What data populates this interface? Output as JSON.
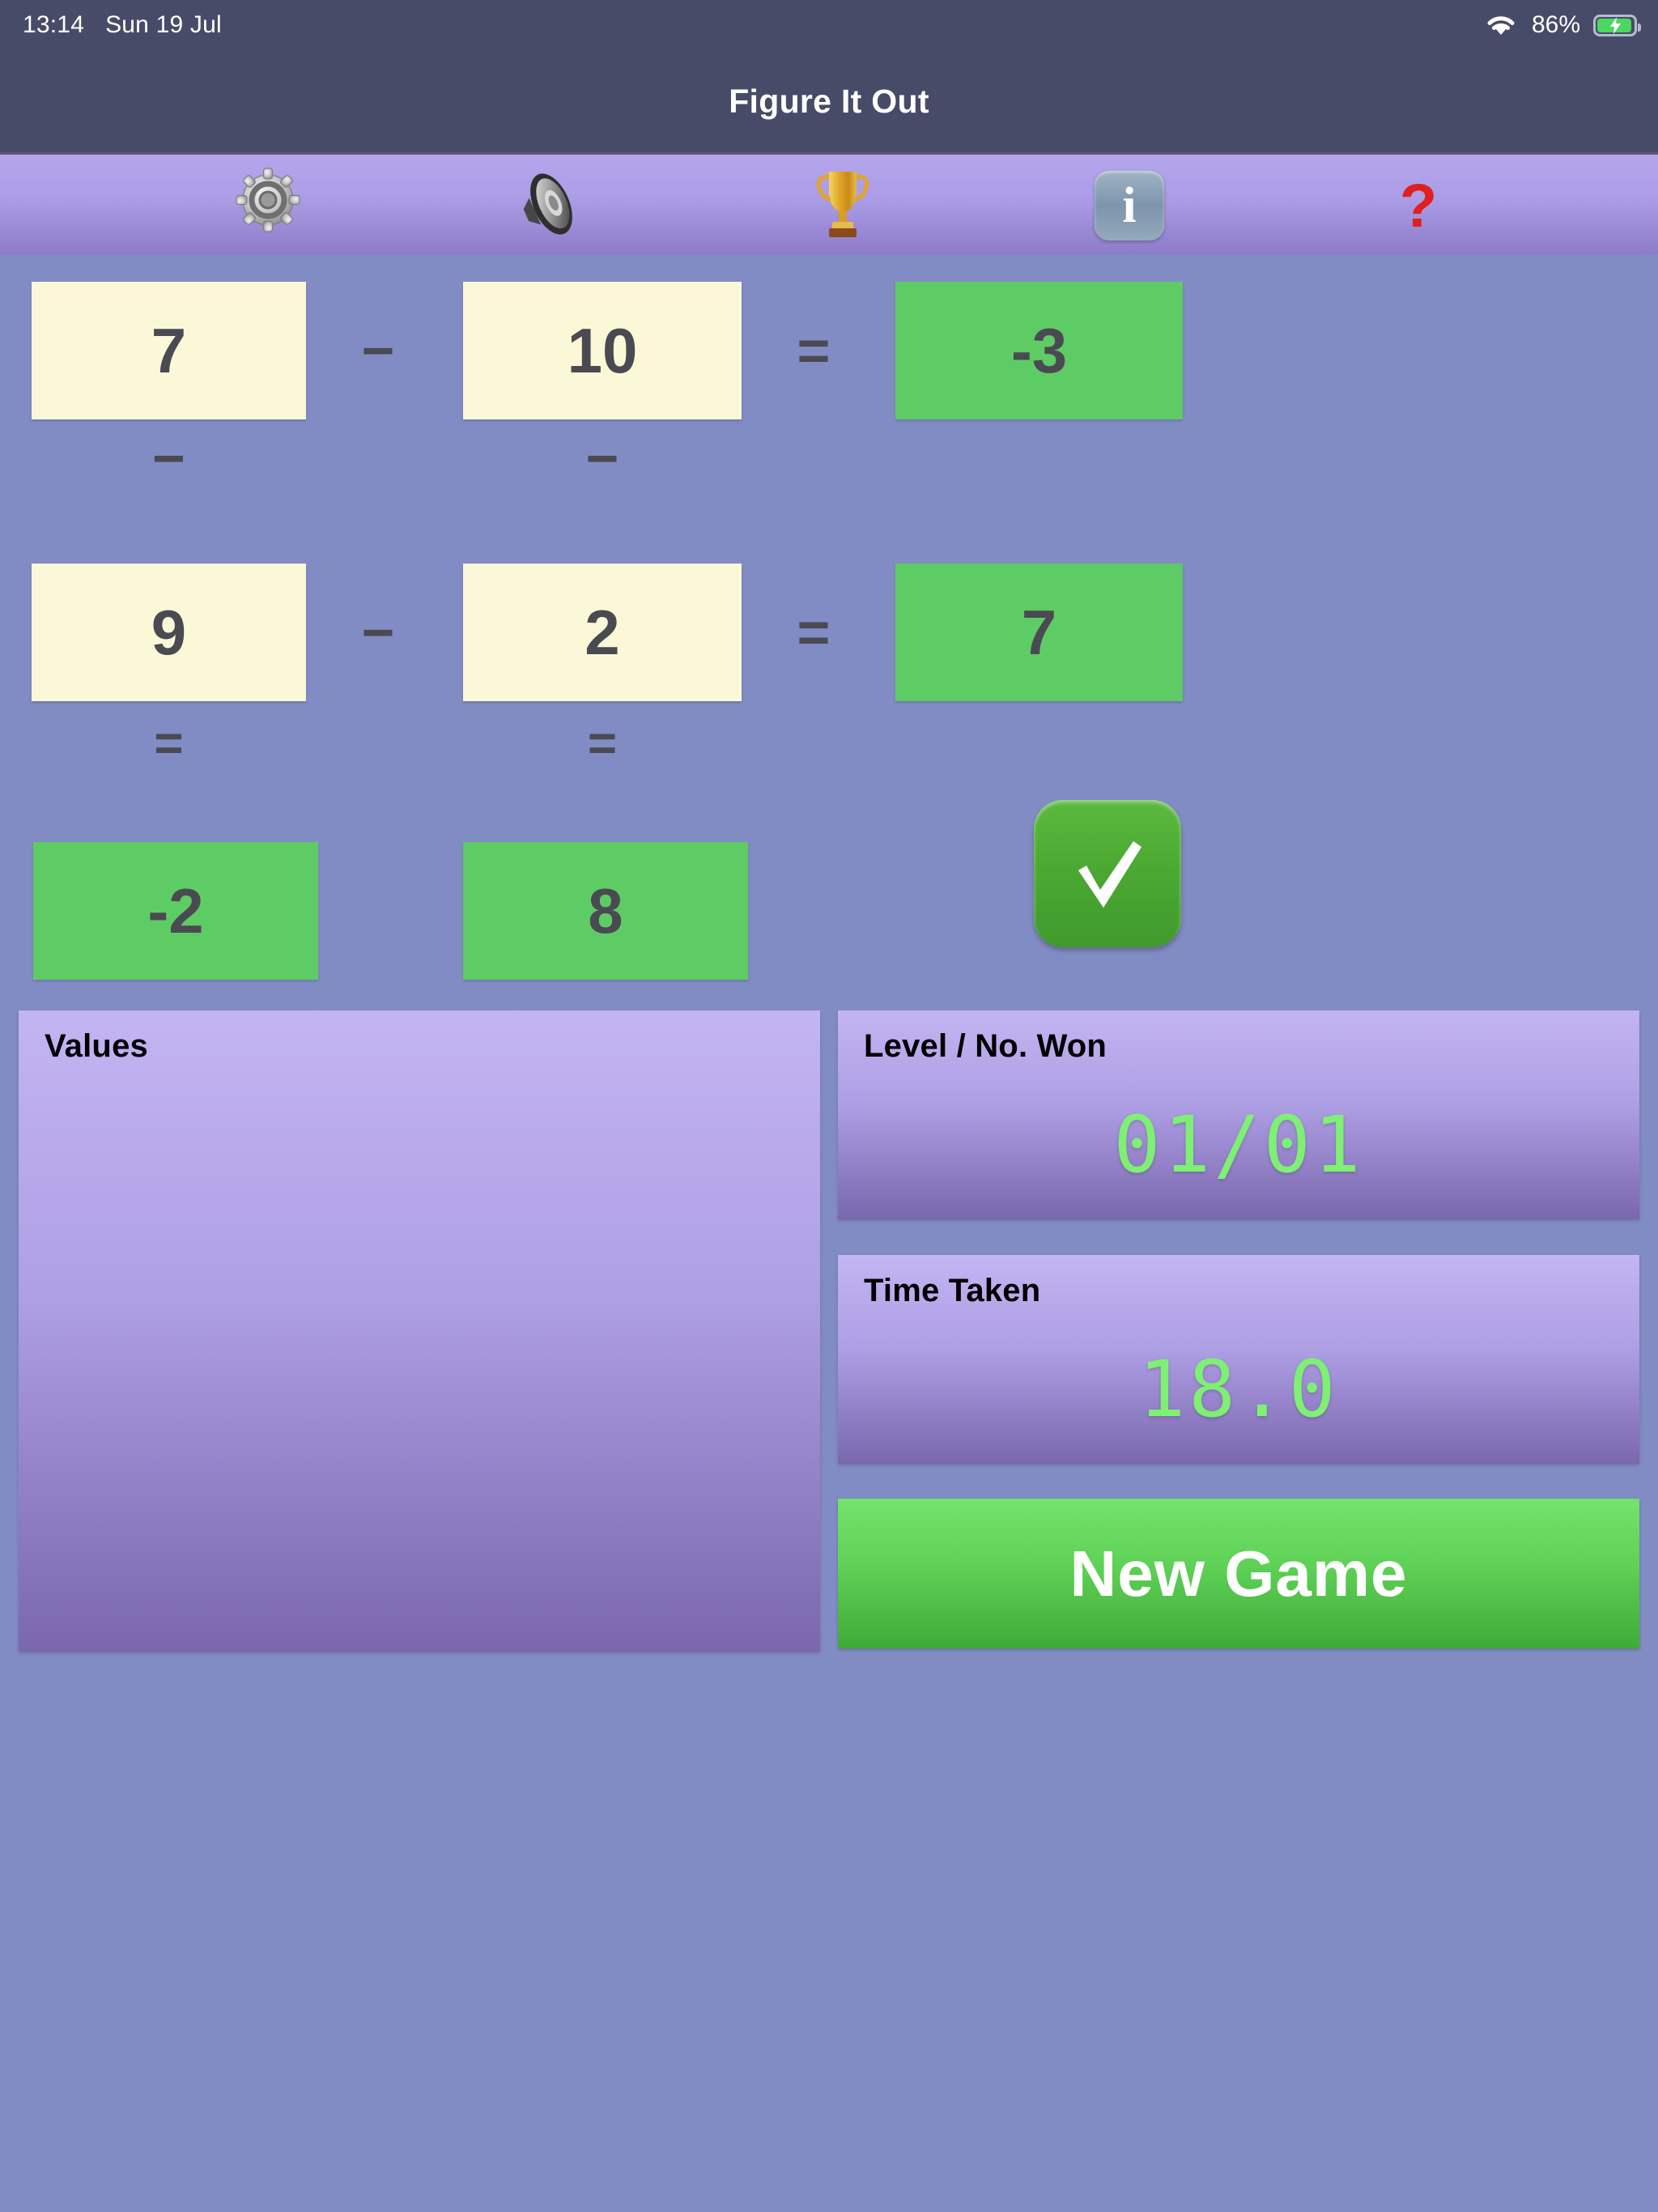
{
  "status_bar": {
    "time": "13:14",
    "date": "Sun 19 Jul",
    "battery_percent": "86%",
    "wifi_icon": "wifi-icon",
    "battery_icon": "battery-charging-icon"
  },
  "app": {
    "title": "Figure It Out"
  },
  "toolbar": {
    "items": [
      {
        "name": "settings-button",
        "icon": "gear-icon",
        "glyph": "⚙️"
      },
      {
        "name": "sound-button",
        "icon": "speaker-icon",
        "glyph": "🔈"
      },
      {
        "name": "high-scores-button",
        "icon": "trophy-icon",
        "glyph": "🏆"
      },
      {
        "name": "info-button",
        "icon": "info-icon",
        "glyph": "i"
      },
      {
        "name": "help-button",
        "icon": "question-mark-icon",
        "glyph": "?"
      }
    ]
  },
  "puzzle": {
    "rows": [
      {
        "a": "7",
        "op": "−",
        "b": "10",
        "eq": "=",
        "result": "-3"
      },
      {
        "a": "9",
        "op": "−",
        "b": "2",
        "eq": "=",
        "result": "7"
      }
    ],
    "column_ops": [
      "−",
      "−"
    ],
    "column_eqs": [
      "=",
      "="
    ],
    "column_results": [
      "-2",
      "8"
    ],
    "check_button_label": "✔"
  },
  "panels": {
    "values": {
      "title": "Values",
      "items": []
    },
    "level": {
      "title": "Level / No. Won",
      "value": "01/01"
    },
    "time": {
      "title": "Time Taken",
      "value": "18.0"
    }
  },
  "actions": {
    "new_game_label": "New Game"
  },
  "colors": {
    "background": "#828cc4",
    "toolbar_top": "#b4a6ec",
    "toolbar_bottom": "#8d7cc7",
    "input_cell": "#fbf8d8",
    "result_cell": "#5ecc64",
    "panel_top": "#c3b4f2",
    "panel_bottom": "#7a67ae",
    "value_green": "#7ef073",
    "new_game_green": "#5ed156",
    "status_bar": "#464c68",
    "question_red": "#e02020"
  }
}
